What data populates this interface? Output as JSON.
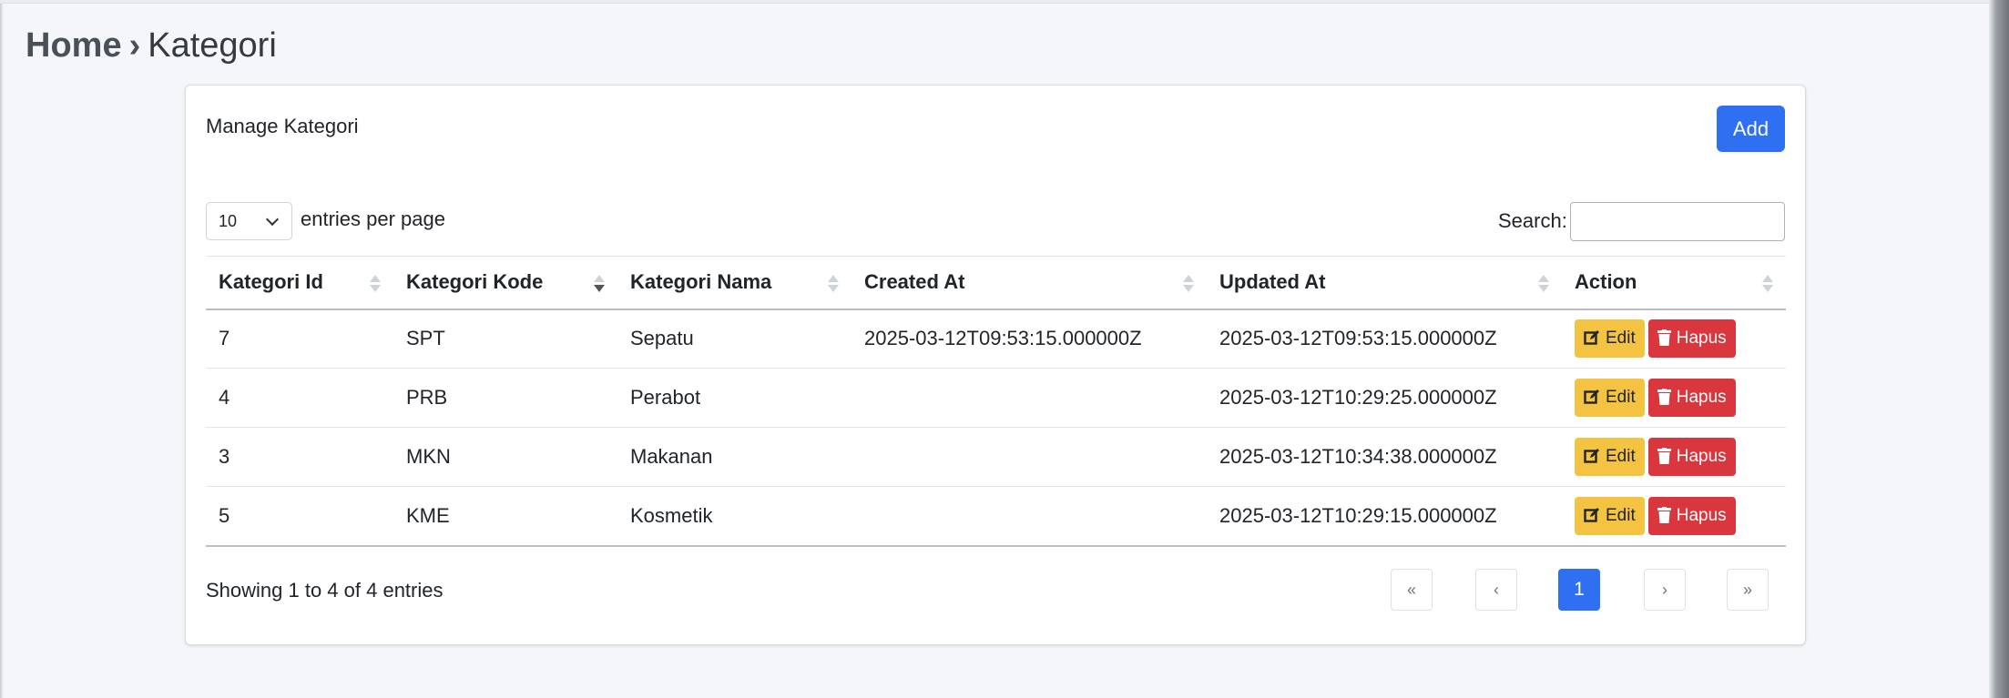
{
  "breadcrumb": {
    "home": "Home",
    "separator": "›",
    "current": "Kategori"
  },
  "card": {
    "title": "Manage Kategori",
    "add_label": "Add"
  },
  "controls": {
    "entries_value": "10",
    "entries_label": "entries per page",
    "search_label": "Search:",
    "search_value": ""
  },
  "table": {
    "headers": {
      "id": "Kategori Id",
      "kode": "Kategori Kode",
      "nama": "Kategori Nama",
      "created": "Created At",
      "updated": "Updated At",
      "action": "Action"
    },
    "rows": [
      {
        "id": "7",
        "kode": "SPT",
        "nama": "Sepatu",
        "created": "2025-03-12T09:53:15.000000Z",
        "updated": "2025-03-12T09:53:15.000000Z"
      },
      {
        "id": "4",
        "kode": "PRB",
        "nama": "Perabot",
        "created": "",
        "updated": "2025-03-12T10:29:25.000000Z"
      },
      {
        "id": "3",
        "kode": "MKN",
        "nama": "Makanan",
        "created": "",
        "updated": "2025-03-12T10:34:38.000000Z"
      },
      {
        "id": "5",
        "kode": "KME",
        "nama": "Kosmetik",
        "created": "",
        "updated": "2025-03-12T10:29:15.000000Z"
      }
    ],
    "edit_label": "Edit",
    "delete_label": "Hapus",
    "sorted_column": "Kategori Kode"
  },
  "footer": {
    "info": "Showing 1 to 4 of 4 entries",
    "pager": {
      "first": "«",
      "prev": "‹",
      "page": "1",
      "next": "›",
      "last": "»"
    }
  },
  "colors": {
    "primary": "#2f6ff2",
    "warning": "#f5c342",
    "danger": "#d9363e"
  }
}
